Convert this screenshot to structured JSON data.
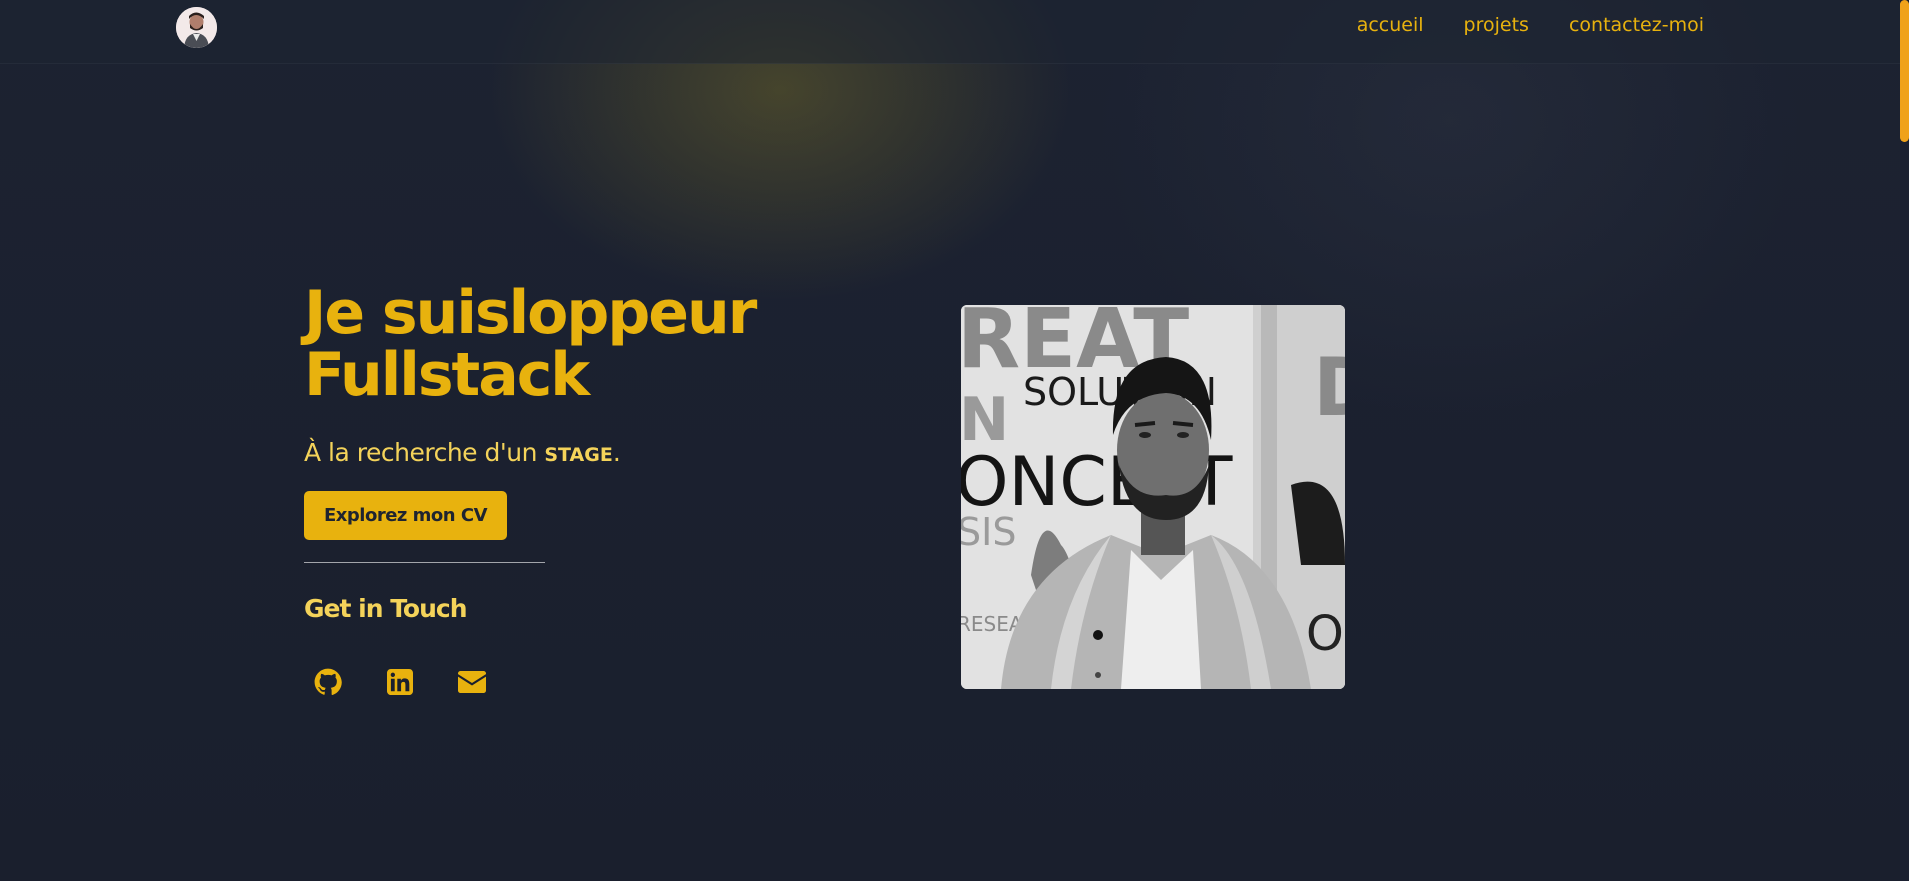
{
  "nav": {
    "items": [
      {
        "label": "accueil"
      },
      {
        "label": "projets"
      },
      {
        "label": "contactez-moi"
      }
    ]
  },
  "hero": {
    "title_line1": "Je suisloppeur",
    "title_line2": "Fullstack",
    "subtitle_prefix": "À la recherche d'un ",
    "subtitle_strong": "STAGE",
    "subtitle_suffix": ".",
    "cv_button": "Explorez mon CV",
    "touch_title": "Get in Touch"
  },
  "photo": {
    "wall_text": [
      "REAT",
      "SOLUTION",
      "N",
      "ONCEPT",
      "SIS",
      "RESEAR",
      "D",
      "ON"
    ]
  },
  "icons": {
    "social": [
      "github-icon",
      "linkedin-icon",
      "envelope-icon"
    ]
  },
  "colors": {
    "accent": "#e8b20e",
    "accent_light": "#f4d35a",
    "background": "#1a1f2e",
    "scrollbar": "#f0a21a"
  }
}
